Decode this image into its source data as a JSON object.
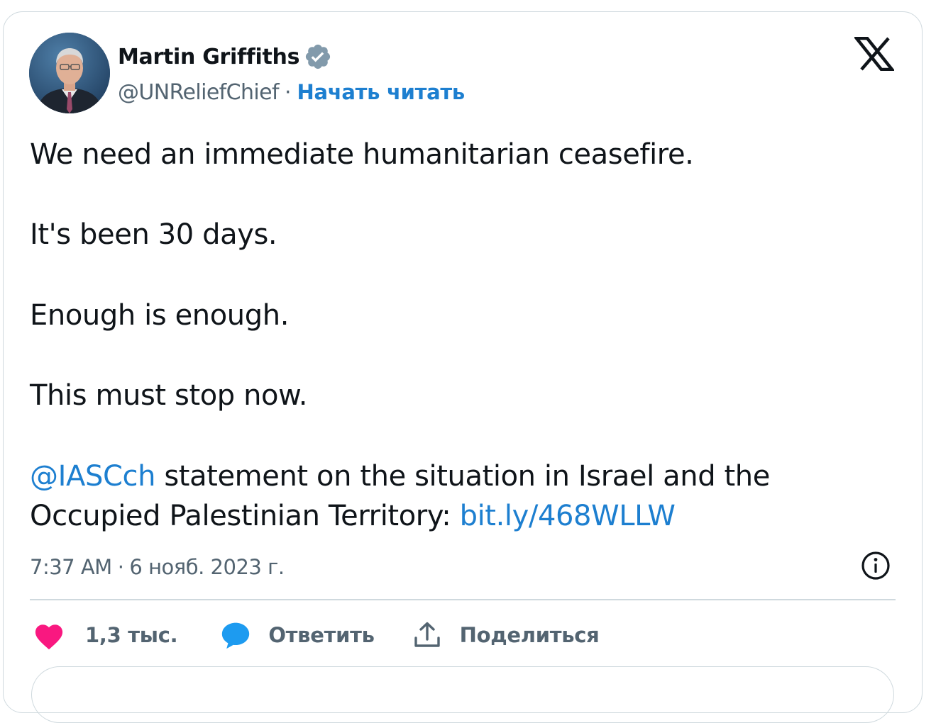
{
  "author": {
    "name": "Martin Griffiths",
    "handle": "@UNReliefChief",
    "separator": "·",
    "follow_label": "Начать читать"
  },
  "tweet": {
    "line1": "We need an immediate humanitarian ceasefire.",
    "line2": "It's been 30 days.",
    "line3": "Enough is enough.",
    "line4": "This must stop now.",
    "mention": "@IASCch",
    "statement_a": " statement on the situation in Israel and the",
    "statement_b": "Occupied Palestinian Territory: ",
    "link": "bit.ly/468WLLW"
  },
  "meta": {
    "time": "7:37 AM",
    "separator": "·",
    "date": "6 нояб. 2023 г."
  },
  "actions": {
    "like_count": "1,3 тыс.",
    "reply_label": "Ответить",
    "share_label": "Поделиться"
  },
  "colors": {
    "link": "#1d7fd0",
    "like": "#f91880",
    "reply": "#1d9bf0",
    "secondary_text": "#536471"
  },
  "icons": [
    "verified-badge-icon",
    "x-logo-icon",
    "info-icon",
    "heart-icon",
    "reply-bubble-icon",
    "share-icon"
  ]
}
